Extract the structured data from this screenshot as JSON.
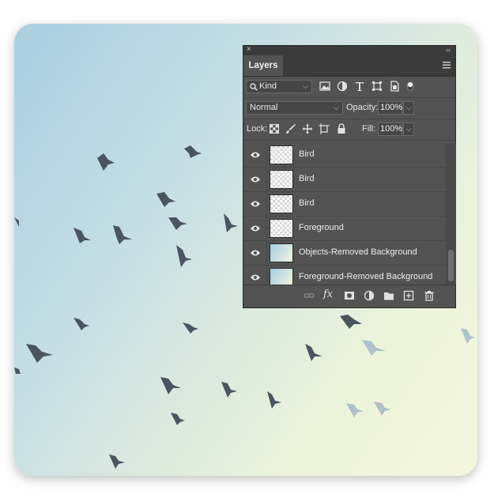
{
  "panel": {
    "close_glyph": "×",
    "collapse_glyph": "‹‹",
    "tab_label": "Layers",
    "filter": {
      "value": "Kind",
      "icons": [
        "search-icon",
        "image-filter-icon",
        "adjustment-filter-icon",
        "type-filter-icon",
        "shape-filter-icon",
        "smart-object-filter-icon",
        "filter-toggle-icon"
      ]
    },
    "blend": {
      "value": "Normal",
      "opacity_label": "Opacity:",
      "opacity_value": "100%"
    },
    "lock": {
      "label": "Lock:",
      "fill_label": "Fill:",
      "fill_value": "100%",
      "icons": [
        "lock-transparent-pixels-icon",
        "lock-image-pixels-icon",
        "lock-position-icon",
        "lock-artboard-icon",
        "lock-all-icon"
      ]
    },
    "layers": [
      {
        "name": "Bird",
        "visible": true,
        "thumb": "transparent"
      },
      {
        "name": "Bird",
        "visible": true,
        "thumb": "transparent"
      },
      {
        "name": "Bird",
        "visible": true,
        "thumb": "transparent"
      },
      {
        "name": "Foreground",
        "visible": true,
        "thumb": "transparent"
      },
      {
        "name": "Objects-Removed Background",
        "visible": true,
        "thumb": "image"
      },
      {
        "name": "Foreground-Removed Background",
        "visible": true,
        "thumb": "image"
      }
    ],
    "footer_icons": [
      "link-layers-icon",
      "fx-icon",
      "add-mask-icon",
      "new-adjustment-icon",
      "new-group-icon",
      "new-layer-icon",
      "delete-layer-icon"
    ],
    "fx_text": "fx",
    "colors": {
      "panel_bg": "#535353",
      "header_bg": "#3b3b3b",
      "text": "#e6e6e6"
    }
  }
}
